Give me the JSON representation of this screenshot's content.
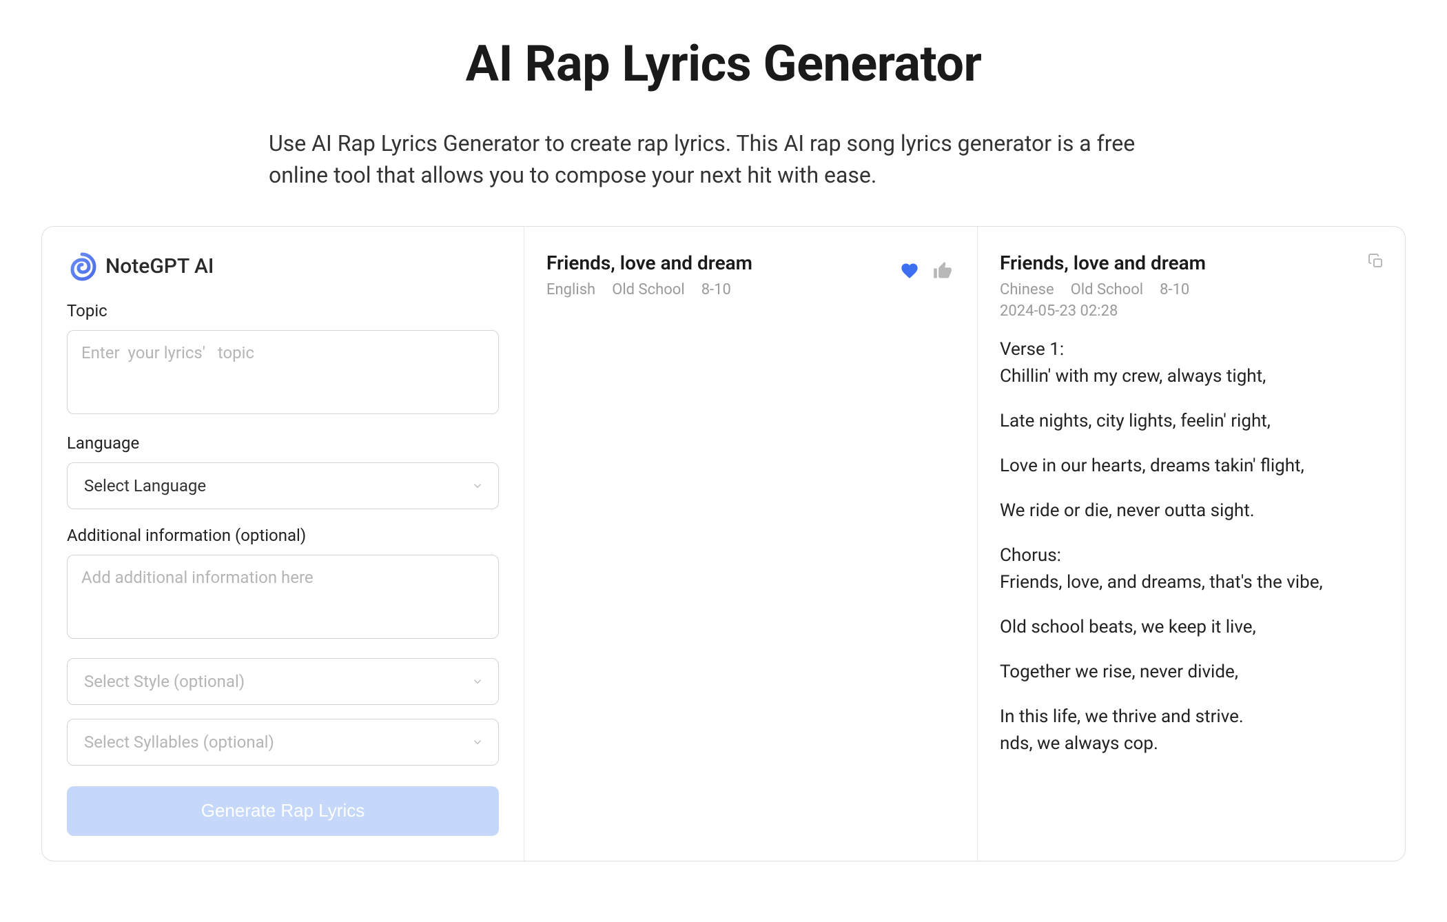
{
  "page": {
    "title": "AI Rap Lyrics Generator",
    "subtitle": "Use AI Rap Lyrics Generator to create rap lyrics. This AI rap song lyrics generator is a free online tool that allows you to compose your next hit with ease."
  },
  "brand": {
    "name": "NoteGPT AI"
  },
  "form": {
    "topic_label": "Topic",
    "topic_placeholder": "Enter  your lyrics'   topic",
    "language_label": "Language",
    "language_placeholder": "Select Language",
    "additional_label": "Additional information (optional)",
    "additional_placeholder": "Add additional information here",
    "style_placeholder": "Select Style (optional)",
    "syllables_placeholder": "Select Syllables (optional)",
    "generate_label": "Generate Rap Lyrics"
  },
  "middle": {
    "title": "Friends, love and dream",
    "meta": {
      "language": "English",
      "style": "Old School",
      "syllables": "8-10"
    }
  },
  "right": {
    "title": "Friends, love and dream",
    "meta": {
      "language": "Chinese",
      "style": "Old School",
      "syllables": "8-10"
    },
    "timestamp": "2024-05-23 02:28",
    "lyrics": [
      "Verse 1:\nChillin' with my crew, always tight,",
      "Late nights, city lights, feelin' right,",
      "Love in our hearts, dreams takin' flight,",
      "We ride or die, never outta sight.",
      "Chorus:\nFriends, love, and dreams, that's the vibe,",
      "Old school beats, we keep it live,",
      "Together we rise, never divide,",
      "In this life, we thrive and strive.\nnds, we always cop."
    ]
  }
}
